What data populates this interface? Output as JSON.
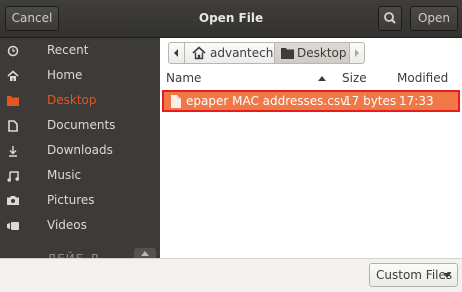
{
  "header": {
    "title": "Open File",
    "cancel_label": "Cancel",
    "open_label": "Open",
    "search_icon": "search-icon"
  },
  "sidebar": {
    "items": [
      {
        "label": "Recent",
        "icon": "clock-icon"
      },
      {
        "label": "Home",
        "icon": "home-icon"
      },
      {
        "label": "Desktop",
        "icon": "folder-icon"
      },
      {
        "label": "Documents",
        "icon": "document-icon"
      },
      {
        "label": "Downloads",
        "icon": "download-icon"
      },
      {
        "label": "Music",
        "icon": "music-icon"
      },
      {
        "label": "Pictures",
        "icon": "camera-icon"
      },
      {
        "label": "Videos",
        "icon": "video-icon"
      },
      {
        "label": "ЛЕЙБ Д",
        "icon": "drive-icon"
      }
    ],
    "active": "Desktop"
  },
  "pathbar": {
    "back_icon": "chevron-left-icon",
    "home_label": "advantech",
    "current_label": "Desktop",
    "forward_icon": "chevron-right-icon"
  },
  "columns": {
    "name": "Name",
    "size": "Size",
    "modified": "Modified"
  },
  "files": [
    {
      "name": "epaper MAC addresses.csv",
      "size": "17 bytes",
      "modified": "17:33",
      "selected": true
    }
  ],
  "footer": {
    "filter_label": "Custom Files"
  },
  "colors": {
    "accent": "#e95420",
    "selection": "#f07746",
    "highlight_border": "#e81c1c",
    "sidebar_bg": "#3c3b37"
  }
}
